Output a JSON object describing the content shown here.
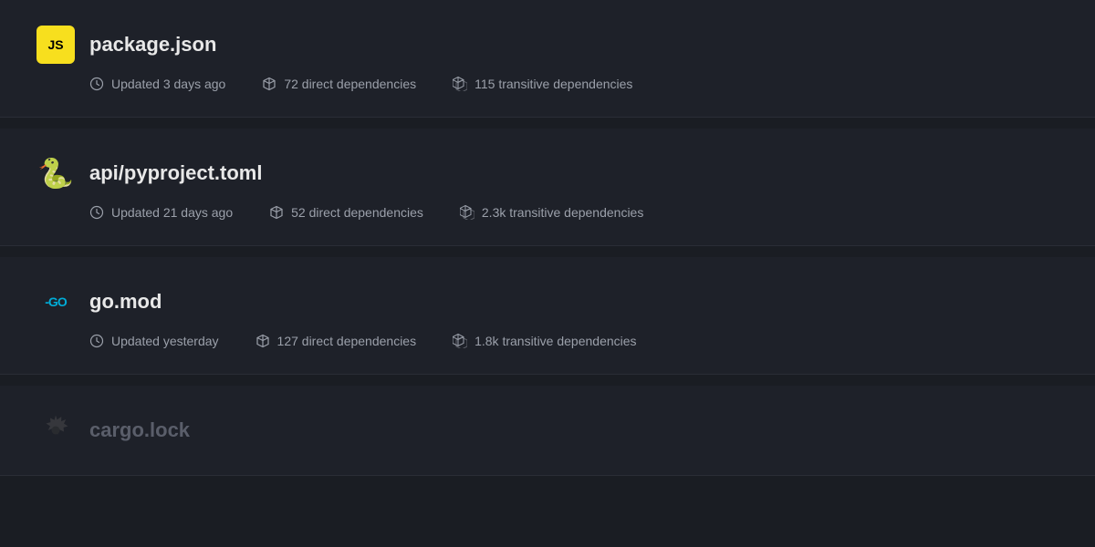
{
  "packages": [
    {
      "id": "package-json",
      "name": "package.json",
      "icon_type": "js",
      "icon_label": "JS",
      "updated": "Updated 3 days ago",
      "direct_deps": "72 direct dependencies",
      "transitive_deps": "115 transitive dependencies",
      "dimmed": false
    },
    {
      "id": "api-pyproject",
      "name": "api/pyproject.toml",
      "icon_type": "py",
      "icon_label": "🐍",
      "updated": "Updated 21 days ago",
      "direct_deps": "52 direct dependencies",
      "transitive_deps": "2.3k transitive dependencies",
      "dimmed": false
    },
    {
      "id": "go-mod",
      "name": "go.mod",
      "icon_type": "go",
      "icon_label": "-GO",
      "updated": "Updated yesterday",
      "direct_deps": "127 direct dependencies",
      "transitive_deps": "1.8k transitive dependencies",
      "dimmed": false
    },
    {
      "id": "cargo-lock",
      "name": "cargo.lock",
      "icon_type": "rust",
      "icon_label": "⚙",
      "updated": "",
      "direct_deps": "",
      "transitive_deps": "",
      "dimmed": true
    }
  ]
}
